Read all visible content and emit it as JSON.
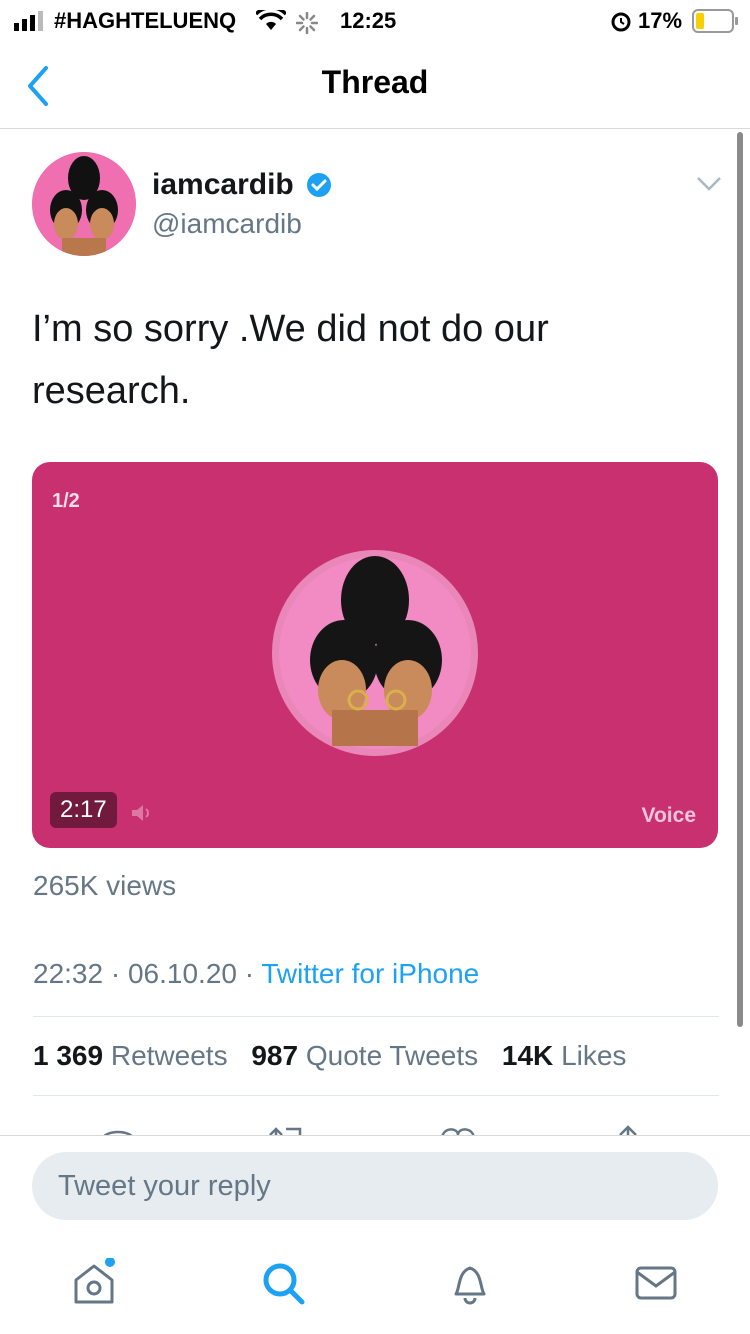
{
  "status_bar": {
    "carrier": "#HAGHTELUENQ",
    "time": "12:25",
    "battery": "17%"
  },
  "nav": {
    "title": "Thread",
    "back_icon": "chevron-left-icon"
  },
  "tweet": {
    "display_name": "iamcardib",
    "handle": "@iamcardib",
    "verified": true,
    "text": "I’m so sorry .We did not do our research.",
    "media": {
      "counter": "1/2",
      "duration": "2:17",
      "type_label": "Voice",
      "background": "#c93070"
    },
    "views": "265K views",
    "time": "22:32",
    "date": "06.10.20",
    "source": "Twitter for iPhone",
    "stats": {
      "retweets_count": "1 369",
      "retweets_label": "Retweets",
      "quotes_count": "987",
      "quotes_label": "Quote Tweets",
      "likes_count": "14K",
      "likes_label": "Likes"
    }
  },
  "reply": {
    "placeholder": "Tweet your reply"
  },
  "tab_bar": {
    "items": [
      "home-icon",
      "search-icon",
      "notifications-icon",
      "messages-icon"
    ]
  },
  "colors": {
    "accent": "#1da1f2",
    "muted": "#657786"
  }
}
